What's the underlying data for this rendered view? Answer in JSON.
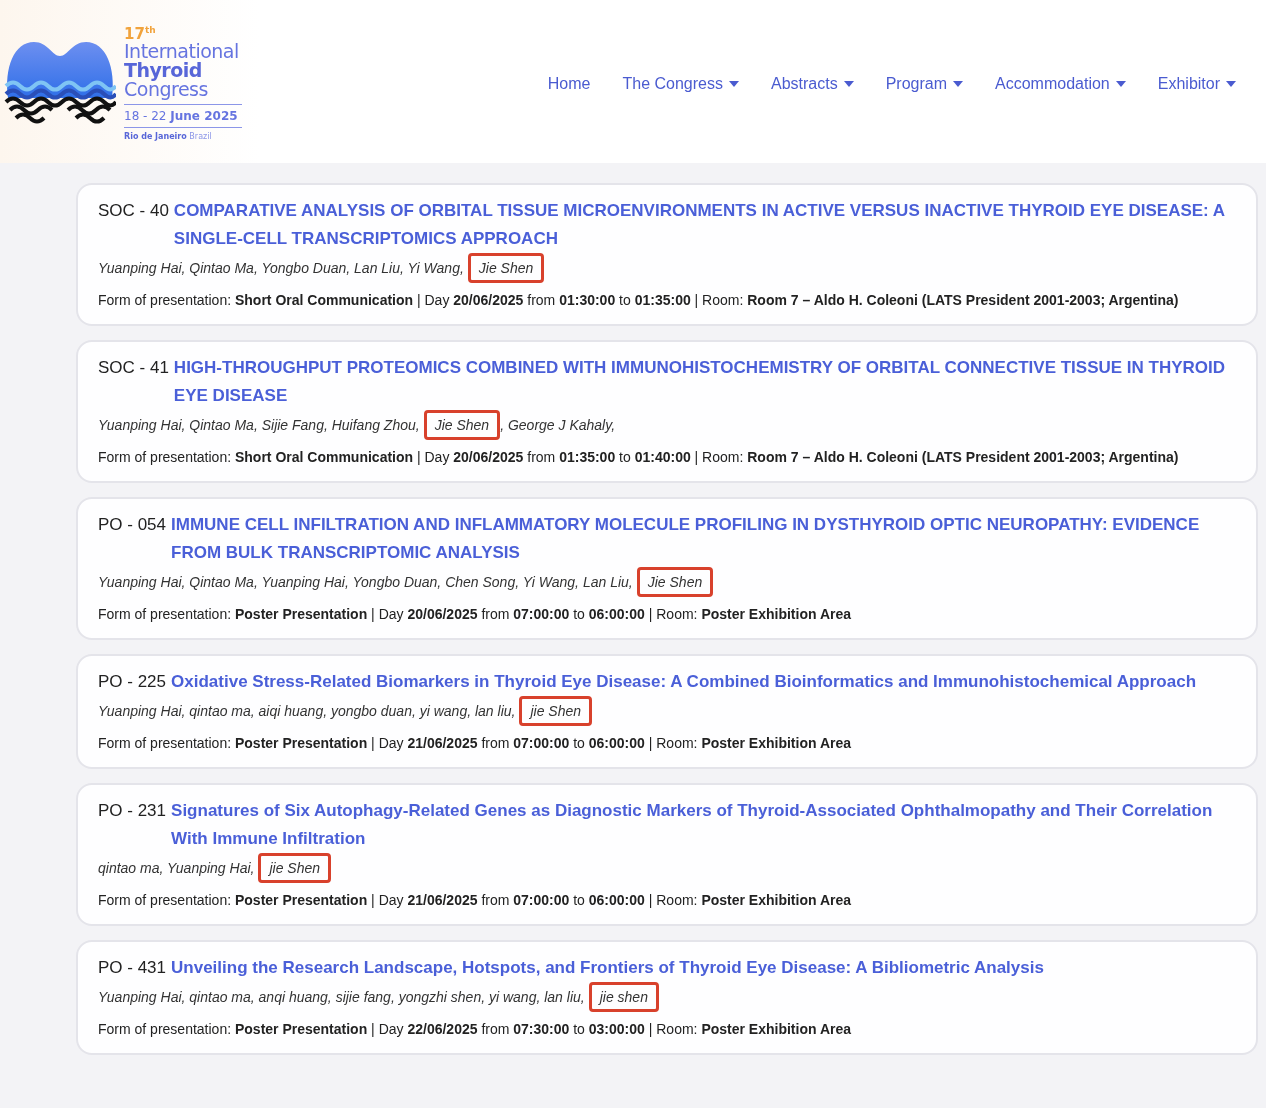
{
  "logo": {
    "edition": "17$^{th}$",
    "line1": "International",
    "line2": "Thyroid",
    "line3": "Congress",
    "dates": "18 - 22 **June 2025**",
    "place": "**Rio de Janeiro** Brazil"
  },
  "nav": [
    {
      "label": "Home",
      "dropdown": false
    },
    {
      "label": "The Congress",
      "dropdown": true
    },
    {
      "label": "Abstracts",
      "dropdown": true
    },
    {
      "label": "Program",
      "dropdown": true
    },
    {
      "label": "Accommodation",
      "dropdown": true
    },
    {
      "label": "Exhibitor",
      "dropdown": true
    }
  ],
  "abstracts": [
    {
      "code": "SOC - 40",
      "title": "COMPARATIVE ANALYSIS OF ORBITAL TISSUE MICROENVIRONMENTS IN ACTIVE VERSUS INACTIVE THYROID EYE DISEASE: A SINGLE-CELL TRANSCRIPTOMICS APPROACH",
      "authors": [
        {
          "text": "Yuanping Hai, Qintao Ma, Yongbo Duan, Lan Liu, Yi Wang,",
          "highlighted": false
        },
        {
          "text": "Jie Shen",
          "highlighted": true
        }
      ],
      "details": "Form of presentation: **Short Oral Communication** | Day **20/06/2025** from **01:30:00** to **01:35:00** | Room: **Room 7 – Aldo H. Coleoni (LATS President 2001-2003; Argentina)**"
    },
    {
      "code": "SOC - 41",
      "title": "HIGH-THROUGHPUT PROTEOMICS COMBINED WITH IMMUNOHISTOCHEMISTRY OF ORBITAL CONNECTIVE TISSUE IN THYROID EYE DISEASE",
      "authors": [
        {
          "text": "Yuanping Hai, Qintao Ma, Sijie Fang, Huifang Zhou,",
          "highlighted": false
        },
        {
          "text": "Jie Shen",
          "highlighted": true
        },
        {
          "text": ", George J Kahaly,",
          "highlighted": false
        }
      ],
      "details": "Form of presentation: **Short Oral Communication** | Day **20/06/2025** from **01:35:00** to **01:40:00** | Room: **Room 7 – Aldo H. Coleoni (LATS President 2001-2003; Argentina)**"
    },
    {
      "code": "PO - 054",
      "title": "IMMUNE CELL INFILTRATION AND INFLAMMATORY MOLECULE PROFILING IN DYSTHYROID OPTIC NEUROPATHY: EVIDENCE FROM BULK TRANSCRIPTOMIC ANALYSIS",
      "authors": [
        {
          "text": "Yuanping Hai, Qintao Ma, Yuanping Hai, Yongbo Duan, Chen Song, Yi Wang, Lan Liu,",
          "highlighted": false
        },
        {
          "text": "Jie Shen",
          "highlighted": true
        }
      ],
      "details": "Form of presentation: **Poster Presentation** | Day **20/06/2025** from **07:00:00** to **06:00:00** | Room: **Poster Exhibition Area**"
    },
    {
      "code": "PO - 225",
      "title": "Oxidative Stress-Related Biomarkers in Thyroid Eye Disease: A Combined Bioinformatics and Immunohistochemical Approach",
      "authors": [
        {
          "text": "Yuanping Hai, qintao ma, aiqi huang, yongbo duan, yi wang, lan liu,",
          "highlighted": false
        },
        {
          "text": "jie Shen",
          "highlighted": true
        }
      ],
      "details": "Form of presentation: **Poster Presentation** | Day **21/06/2025** from **07:00:00** to **06:00:00** | Room: **Poster Exhibition Area**"
    },
    {
      "code": "PO - 231",
      "title": "Signatures of Six Autophagy-Related Genes as Diagnostic Markers of Thyroid-Associated Ophthalmopathy and Their Correlation With Immune Infiltration",
      "authors": [
        {
          "text": "qintao ma, Yuanping Hai,",
          "highlighted": false
        },
        {
          "text": "jie Shen",
          "highlighted": true
        }
      ],
      "details": "Form of presentation: **Poster Presentation** | Day **21/06/2025** from **07:00:00** to **06:00:00** | Room: **Poster Exhibition Area**"
    },
    {
      "code": "PO - 431",
      "title": "Unveiling the Research Landscape, Hotspots, and Frontiers of Thyroid Eye Disease: A Bibliometric Analysis",
      "authors": [
        {
          "text": "Yuanping Hai, qintao ma, anqi huang, sijie fang, yongzhi shen, yi wang, lan liu,",
          "highlighted": false
        },
        {
          "text": "jie shen",
          "highlighted": true
        }
      ],
      "details": "Form of presentation: **Poster Presentation** | Day **22/06/2025** from **07:30:00** to **03:00:00** | Room: **Poster Exhibition Area**"
    }
  ]
}
